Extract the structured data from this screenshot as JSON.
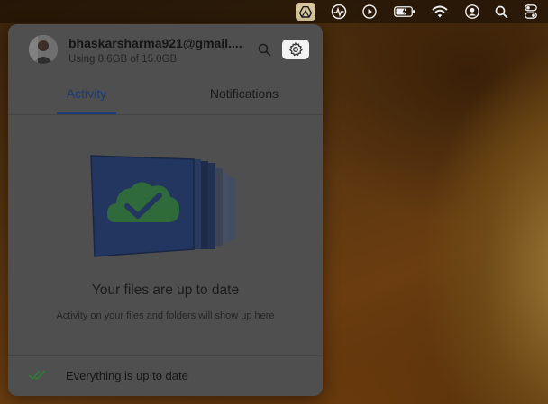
{
  "menubar": {
    "icons": [
      "google-drive-icon",
      "activity-monitor-icon",
      "play-icon",
      "battery-icon",
      "wifi-icon",
      "user-icon",
      "search-icon",
      "control-center-icon"
    ]
  },
  "account": {
    "email": "bhaskarsharma921@gmail....",
    "usage": "Using 8.6GB of 15.0GB"
  },
  "tabs": {
    "activity": "Activity",
    "notifications": "Notifications"
  },
  "empty_state": {
    "title": "Your files are up to date",
    "subtitle": "Activity on your files and folders will show up here"
  },
  "status": {
    "text": "Everything is up to date"
  },
  "colors": {
    "panel_bg": "#4f4f4f",
    "tab_active": "#1b3a7a",
    "status_check": "#2f7a3a",
    "drive_tray_highlight": "#d8c79c"
  }
}
